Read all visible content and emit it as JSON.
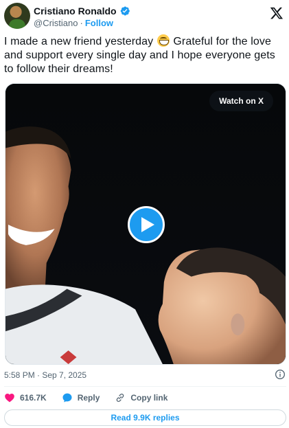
{
  "author": {
    "name": "Cristiano Ronaldo",
    "handle": "@Cristiano",
    "separator": "·",
    "follow_label": "Follow",
    "avatar_icon": "avatar-photo",
    "verified_icon": "verified-badge-icon"
  },
  "platform_icon": "x-logo-icon",
  "tweet": {
    "text_part1": "I made a new friend yesterday",
    "emoji_icon": "grinning-face-emoji",
    "text_part2": " Grateful for the love and support every single day and I hope everyone gets to follow their dreams!"
  },
  "media": {
    "watch_label": "Watch on X",
    "play_icon": "play-icon"
  },
  "timestamp": "5:58 PM · Sep 7, 2025",
  "actions": {
    "likes_count": "616.7K",
    "like_icon": "heart-icon",
    "reply_label": "Reply",
    "reply_icon": "reply-bubble-icon",
    "copy_label": "Copy link",
    "copy_icon": "link-icon"
  },
  "read_replies_label": "Read 9.9K replies",
  "colors": {
    "accent": "#1d9bf0",
    "like": "#f91880",
    "text": "#0f1419",
    "muted": "#536471"
  }
}
